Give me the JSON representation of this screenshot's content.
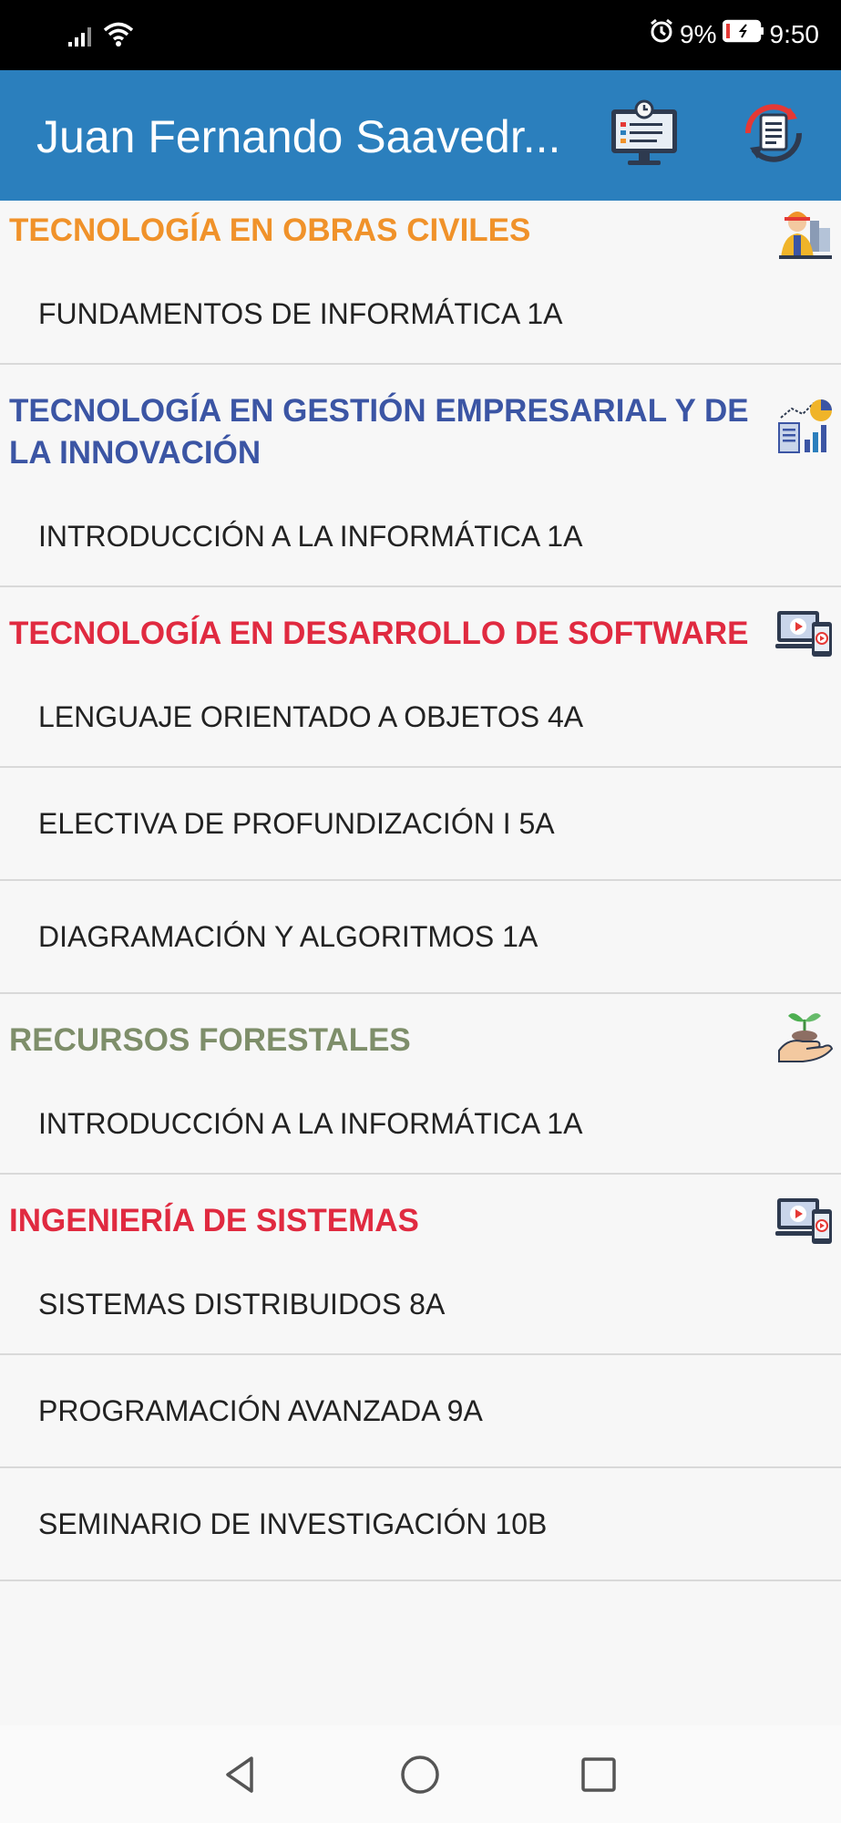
{
  "status_bar": {
    "battery": "9%",
    "time": "9:50",
    "icons": [
      "signal-icon",
      "wifi-icon",
      "alarm-icon",
      "battery-icon"
    ]
  },
  "app_bar": {
    "title": "Juan Fernando Saavedr...",
    "actions": [
      "schedule-icon",
      "refresh-document-icon"
    ]
  },
  "sections": [
    {
      "title": "TECNOLOGÍA EN OBRAS CIVILES",
      "color": "#f0922a",
      "icon": "construction-worker-icon",
      "courses": [
        "FUNDAMENTOS DE INFORMÁTICA 1A"
      ]
    },
    {
      "title": "TECNOLOGÍA EN GESTIÓN EMPRESARIAL Y DE LA INNOVACIÓN",
      "color": "#3b55a4",
      "icon": "business-chart-icon",
      "courses": [
        "INTRODUCCIÓN A LA INFORMÁTICA 1A"
      ]
    },
    {
      "title": "TECNOLOGÍA EN DESARROLLO DE SOFTWARE",
      "color": "#e02a40",
      "icon": "devices-video-icon",
      "courses": [
        "LENGUAJE ORIENTADO A OBJETOS 4A",
        "ELECTIVA DE PROFUNDIZACIÓN I 5A",
        "DIAGRAMACIÓN Y ALGORITMOS 1A"
      ]
    },
    {
      "title": "RECURSOS FORESTALES",
      "color": "#7e8e6a",
      "icon": "plant-hand-icon",
      "courses": [
        "INTRODUCCIÓN A LA INFORMÁTICA 1A"
      ]
    },
    {
      "title": "INGENIERÍA DE SISTEMAS",
      "color": "#e02a40",
      "icon": "devices-video-icon",
      "courses": [
        "SISTEMAS DISTRIBUIDOS 8A",
        "PROGRAMACIÓN AVANZADA 9A",
        "SEMINARIO DE INVESTIGACIÓN 10B"
      ]
    }
  ],
  "nav_bar": {
    "buttons": [
      "back-icon",
      "home-icon",
      "recents-icon"
    ]
  },
  "colors": {
    "app_bar": "#2b7fbd",
    "status_bar": "#000000",
    "background": "#f7f7f7"
  }
}
